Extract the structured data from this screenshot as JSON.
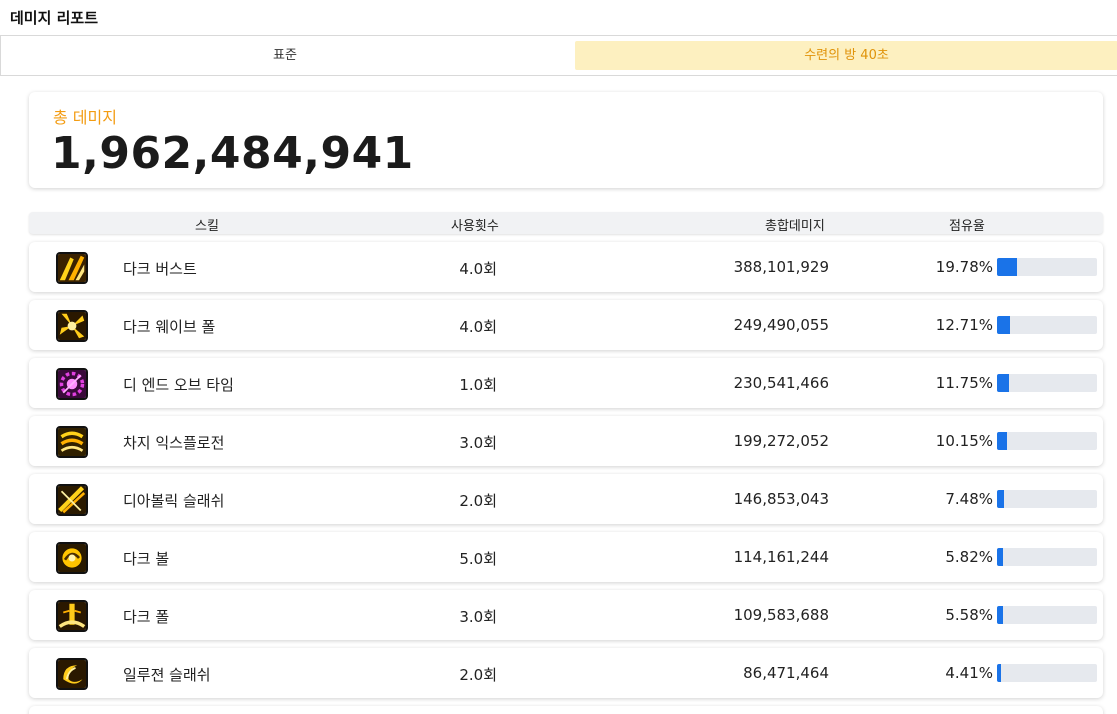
{
  "header": {
    "title": "데미지 리포트"
  },
  "tabs": [
    {
      "label": "표준"
    },
    {
      "label": "수련의 방 40초"
    }
  ],
  "total": {
    "label": "총 데미지",
    "value": "1,962,484,941"
  },
  "table": {
    "headers": {
      "skill": "스킬",
      "uses": "사용횟수",
      "damage": "총합데미지",
      "share": "점유율"
    },
    "rows": [
      {
        "name": "다크 버스트",
        "uses": "4.0회",
        "damage": "388,101,929",
        "share": "19.78%",
        "share_value": 19.78,
        "icon": "dark-burst-icon"
      },
      {
        "name": "다크 웨이브 폴",
        "uses": "4.0회",
        "damage": "249,490,055",
        "share": "12.71%",
        "share_value": 12.71,
        "icon": "dark-wave-fall-icon"
      },
      {
        "name": "디 엔드 오브 타임",
        "uses": "1.0회",
        "damage": "230,541,466",
        "share": "11.75%",
        "share_value": 11.75,
        "icon": "end-of-time-icon"
      },
      {
        "name": "차지 익스플로전",
        "uses": "3.0회",
        "damage": "199,272,052",
        "share": "10.15%",
        "share_value": 10.15,
        "icon": "charge-explosion-icon"
      },
      {
        "name": "디아볼릭 슬래쉬",
        "uses": "2.0회",
        "damage": "146,853,043",
        "share": "7.48%",
        "share_value": 7.48,
        "icon": "diabolic-slash-icon"
      },
      {
        "name": "다크 볼",
        "uses": "5.0회",
        "damage": "114,161,244",
        "share": "5.82%",
        "share_value": 5.82,
        "icon": "dark-ball-icon"
      },
      {
        "name": "다크 폴",
        "uses": "3.0회",
        "damage": "109,583,688",
        "share": "5.58%",
        "share_value": 5.58,
        "icon": "dark-fall-icon"
      },
      {
        "name": "일루젼 슬래쉬",
        "uses": "2.0회",
        "damage": "86,471,464",
        "share": "4.41%",
        "share_value": 4.41,
        "icon": "illusion-slash-icon"
      }
    ]
  },
  "colors": {
    "accent": "#f39c12",
    "tab_active_bg": "#fdf0c0",
    "bar_fill": "#1a73e8",
    "bar_track": "#e6e9ee"
  }
}
